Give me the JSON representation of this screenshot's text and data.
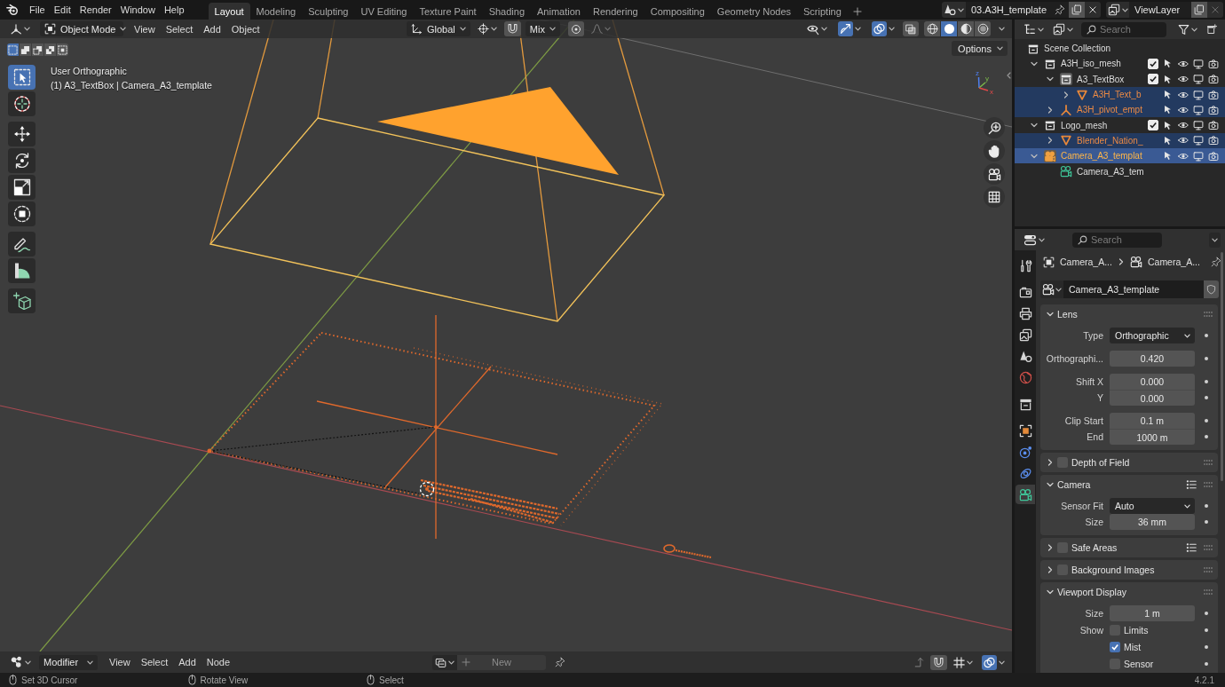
{
  "top_bar": {
    "menus": [
      "File",
      "Edit",
      "Render",
      "Window",
      "Help"
    ],
    "workspace_tabs": [
      {
        "label": "Layout",
        "selected": true
      },
      {
        "label": "Modeling",
        "selected": false
      },
      {
        "label": "Sculpting",
        "selected": false
      },
      {
        "label": "UV Editing",
        "selected": false
      },
      {
        "label": "Texture Paint",
        "selected": false
      },
      {
        "label": "Shading",
        "selected": false
      },
      {
        "label": "Animation",
        "selected": false
      },
      {
        "label": "Rendering",
        "selected": false
      },
      {
        "label": "Compositing",
        "selected": false
      },
      {
        "label": "Geometry Nodes",
        "selected": false
      },
      {
        "label": "Scripting",
        "selected": false
      }
    ],
    "scene": "03.A3H_template",
    "view_layer": "ViewLayer"
  },
  "viewport": {
    "header": {
      "mode": "Object Mode",
      "menus": [
        "View",
        "Select",
        "Add",
        "Object"
      ],
      "orientation": "Global",
      "snap_target": "Mix",
      "gizmos_on": true,
      "overlays_on": true,
      "shading_modes": [
        {
          "kind": "wireframe",
          "selected": false
        },
        {
          "kind": "solid",
          "selected": true
        },
        {
          "kind": "material",
          "selected": false
        },
        {
          "kind": "rendered",
          "selected": false
        }
      ]
    },
    "select_modes": [
      {
        "kind": "new",
        "selected": true
      },
      {
        "kind": "extend",
        "selected": false
      },
      {
        "kind": "subtract",
        "selected": false
      },
      {
        "kind": "difference",
        "selected": false
      },
      {
        "kind": "intersect",
        "selected": false
      }
    ],
    "options": "Options",
    "info": [
      "User Orthographic",
      "(1) A3_TextBox | Camera_A3_template"
    ],
    "axis_labels": [
      "z",
      "y",
      "x"
    ],
    "tool_groups": [
      {
        "tools": [
          {
            "kind": "select_box",
            "selected": true
          },
          {
            "kind": "cursor",
            "selected": false
          }
        ]
      },
      {
        "tools": [
          {
            "kind": "move",
            "selected": false
          },
          {
            "kind": "rotate",
            "selected": false
          },
          {
            "kind": "scale",
            "selected": false
          },
          {
            "kind": "transform",
            "selected": false
          }
        ]
      },
      {
        "tools": [
          {
            "kind": "annotate",
            "selected": false
          },
          {
            "kind": "measure",
            "selected": false
          }
        ]
      },
      {
        "tools": [
          {
            "kind": "add_cube",
            "selected": false
          }
        ]
      }
    ]
  },
  "outliner": {
    "search": {
      "placeholder": "Search"
    },
    "root": "Scene Collection",
    "items": [
      {
        "kind": "collection",
        "name": "A3H_iso_mesh",
        "expanded": true,
        "checked": true,
        "selected": false,
        "active": false,
        "children": [
          {
            "kind": "collection",
            "name": "A3_TextBox",
            "expanded": true,
            "checked": true,
            "selected": false,
            "active": true,
            "children": [
              {
                "kind": "mesh",
                "name": "A3H_Text_b",
                "expanded": false,
                "selected": true,
                "active": false
              }
            ]
          },
          {
            "kind": "empty",
            "name": "A3H_pivot_empt",
            "expanded": false,
            "selected": true,
            "active": false
          }
        ]
      },
      {
        "kind": "collection",
        "name": "Logo_mesh",
        "expanded": true,
        "checked": true,
        "selected": false,
        "active": false,
        "children": [
          {
            "kind": "mesh",
            "name": "Blender_Nation_",
            "expanded": false,
            "selected": true,
            "active": false
          }
        ]
      },
      {
        "kind": "camera",
        "name": "Camera_A3_templat",
        "expanded": true,
        "selected": true,
        "active": true,
        "children": [
          {
            "kind": "camera_data",
            "name": "Camera_A3_tem",
            "selected": false,
            "active": false
          }
        ]
      }
    ]
  },
  "properties": {
    "search": {
      "placeholder": "Search"
    },
    "tab_groups": [
      {
        "tabs": [
          {
            "kind": "tool",
            "selected": false
          }
        ]
      },
      {
        "tabs": [
          {
            "kind": "render",
            "selected": false
          },
          {
            "kind": "output",
            "selected": false
          },
          {
            "kind": "view_layer",
            "selected": false
          },
          {
            "kind": "scene",
            "selected": false
          },
          {
            "kind": "world",
            "selected": false
          }
        ]
      },
      {
        "tabs": [
          {
            "kind": "collection",
            "selected": false
          }
        ]
      },
      {
        "tabs": [
          {
            "kind": "object",
            "selected": false
          },
          {
            "kind": "physics",
            "selected": false
          },
          {
            "kind": "constraints",
            "selected": false
          },
          {
            "kind": "camera_data",
            "selected": true
          }
        ]
      }
    ],
    "breadcrumb": [
      "Camera_A...",
      "Camera_A..."
    ],
    "datablock": "Camera_A3_template",
    "panels": [
      {
        "title": "Lens",
        "expanded": true,
        "groups": [
          {
            "rows": [
              {
                "kind": "dropdown",
                "label": "Type",
                "value": "Orthographic"
              }
            ]
          },
          {
            "rows": [
              {
                "kind": "number",
                "label": "Orthographi...",
                "value": "0.420"
              }
            ]
          },
          {
            "rows": [
              {
                "kind": "number",
                "label": "Shift X",
                "value": "0.000"
              },
              {
                "kind": "number",
                "label": "Y",
                "value": "0.000"
              }
            ]
          },
          {
            "rows": [
              {
                "kind": "number",
                "label": "Clip Start",
                "value": "0.1 m"
              },
              {
                "kind": "number",
                "label": "End",
                "value": "1000 m"
              }
            ]
          }
        ]
      },
      {
        "title": "Depth of Field",
        "expanded": false,
        "checked": false
      },
      {
        "title": "Camera",
        "expanded": true,
        "presets": true,
        "groups": [
          {
            "rows": [
              {
                "kind": "dropdown",
                "label": "Sensor Fit",
                "value": "Auto"
              },
              {
                "kind": "number",
                "label": "Size",
                "value": "36 mm"
              }
            ]
          }
        ]
      },
      {
        "title": "Safe Areas",
        "expanded": false,
        "checked": false,
        "presets": true
      },
      {
        "title": "Background Images",
        "expanded": false,
        "checked": false
      },
      {
        "title": "Viewport Display",
        "expanded": true,
        "groups": [
          {
            "rows": [
              {
                "kind": "number",
                "label": "Size",
                "value": "1 m"
              },
              {
                "kind": "checkbox",
                "label": "Show",
                "text": "Limits",
                "checked": false
              },
              {
                "kind": "checkbox",
                "text": "Mist",
                "checked": true
              },
              {
                "kind": "checkbox",
                "text": "Sensor",
                "checked": false
              }
            ]
          }
        ]
      }
    ]
  },
  "editor_header": {
    "editor": "Modifier",
    "menus": [
      "View",
      "Select",
      "Add",
      "Node"
    ],
    "new_label": "New",
    "overlays_on": true
  },
  "status_bar": {
    "hints": [
      "Set 3D Cursor",
      "Rotate View",
      "Select"
    ],
    "version": "4.2.1"
  }
}
